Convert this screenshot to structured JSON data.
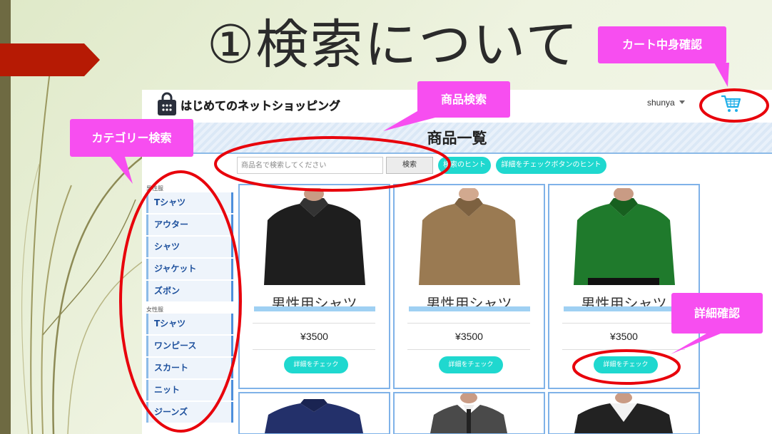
{
  "slide": {
    "title": "①検索について"
  },
  "app": {
    "brand": "はじめてのネットショッピング",
    "user": "shunya",
    "page_heading": "商品一覧",
    "search": {
      "placeholder": "商品名で検索してください",
      "button": "検索"
    },
    "hint_buttons": [
      "検索のヒント",
      "詳細をチェックボタンのヒント"
    ],
    "categories": {
      "men_heading": "男性服",
      "men": [
        "Tシャツ",
        "アウター",
        "シャツ",
        "ジャケット",
        "ズボン"
      ],
      "women_heading": "女性服",
      "women": [
        "Tシャツ",
        "ワンピース",
        "スカート",
        "ニット",
        "ジーンズ"
      ]
    },
    "products": [
      {
        "name": "男性用シャツ",
        "price": "¥3500",
        "button": "詳細をチェック",
        "shirt_color": "#1e1e1e"
      },
      {
        "name": "男性用シャツ",
        "price": "¥3500",
        "button": "詳細をチェック",
        "shirt_color": "#9a7a52"
      },
      {
        "name": "男性用シャツ",
        "price": "¥3500",
        "button": "詳細をチェック",
        "shirt_color": "#1f7a2c"
      }
    ],
    "second_row_shirt_colors": [
      "#23306a",
      "#4a4a4a",
      "#222222"
    ]
  },
  "callouts": {
    "cart": "カート中身確認",
    "search": "商品検索",
    "category": "カテゴリー検索",
    "detail": "詳細確認"
  },
  "colors": {
    "accent_teal": "#1fd8cf",
    "callout_pink": "#f74ef0",
    "highlight_red": "#e8000b",
    "category_text": "#1c4f9c"
  }
}
